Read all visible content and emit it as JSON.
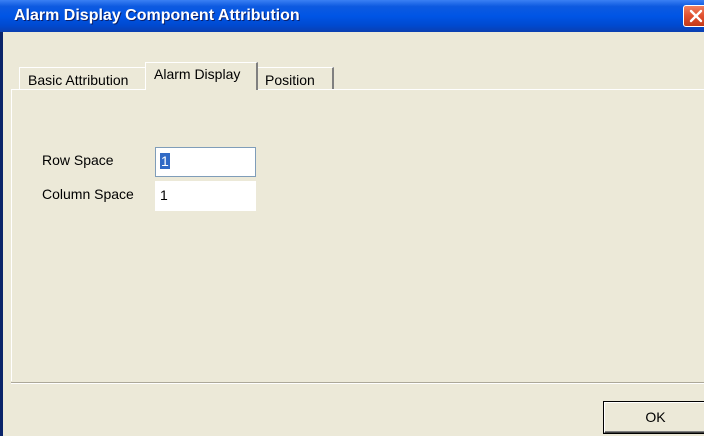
{
  "window": {
    "title": "Alarm Display Component Attribution"
  },
  "tabs": [
    {
      "label": "Basic Attribution",
      "active": false
    },
    {
      "label": "Alarm Display",
      "active": true
    },
    {
      "label": "Position",
      "active": false
    }
  ],
  "form": {
    "row_space_label": "Row Space",
    "row_space_value": "1",
    "column_space_label": "Column Space",
    "column_space_value": "1"
  },
  "buttons": {
    "ok_label": "OK"
  },
  "colors": {
    "titlebar": "#0055e5",
    "dialog_background": "#ece9d8",
    "selection": "#316ac5",
    "close_button": "#e0502f"
  },
  "icons": {
    "close": "close-icon"
  }
}
